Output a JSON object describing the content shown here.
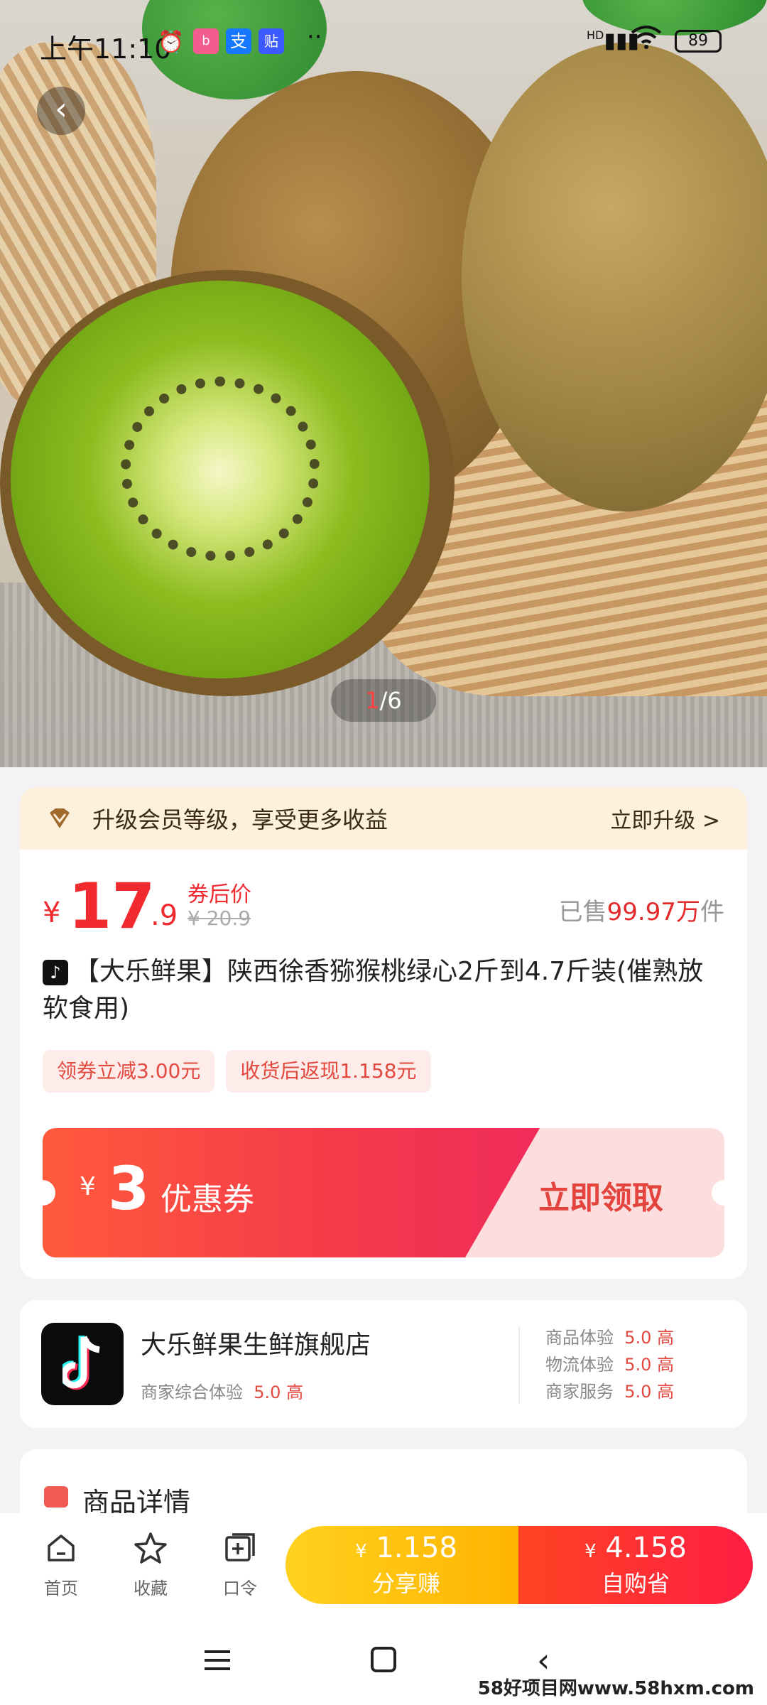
{
  "status_bar": {
    "time": "上午11:10",
    "signal": "HD",
    "battery": "89",
    "notification_icons": [
      "alarm-icon",
      "bilibili-icon",
      "alipay-icon",
      "tieba-icon"
    ]
  },
  "gallery": {
    "current": "1",
    "total": "/6"
  },
  "member_banner": {
    "text": "升级会员等级，享受更多收益",
    "link": "立即升级 >"
  },
  "price": {
    "currency": "¥",
    "integer": "17",
    "decimal": ".9",
    "after_coupon_label": "券后价",
    "original": "¥ 20.9",
    "sold_prefix": "已售",
    "sold_count": "99.97万",
    "sold_suffix": "件"
  },
  "product": {
    "platform_badge": "♪",
    "title": "【大乐鲜果】陕西徐香猕猴桃绿心2斤到4.7斤装(催熟放软食用)"
  },
  "tags": [
    "领券立减3.00元",
    "收货后返现1.158元"
  ],
  "coupon": {
    "currency": "¥",
    "amount": "3",
    "label": "优惠券",
    "claim": "立即领取"
  },
  "shop": {
    "name": "大乐鲜果生鲜旗舰店",
    "overall_label": "商家综合体验",
    "overall_score": "5.0 高",
    "metrics": [
      {
        "label": "商品体验",
        "score": "5.0 高"
      },
      {
        "label": "物流体验",
        "score": "5.0 高"
      },
      {
        "label": "商家服务",
        "score": "5.0 高"
      }
    ]
  },
  "details": {
    "title": "商品详情"
  },
  "bottom_bar": {
    "nav": [
      {
        "label": "首页",
        "icon": "home-icon"
      },
      {
        "label": "收藏",
        "icon": "star-icon"
      },
      {
        "label": "口令",
        "icon": "add-box-icon"
      }
    ],
    "share": {
      "currency": "¥",
      "amount": "1.158",
      "label": "分享赚"
    },
    "buy": {
      "currency": "¥",
      "amount": "4.158",
      "label": "自购省"
    }
  },
  "watermark": "58好项目网www.58hxm.com",
  "colors": {
    "price_red": "#f02a2e",
    "share_yellow": "#ffc20e",
    "buy_red": "#ff2a36",
    "member_bg": "#fdf0dd"
  }
}
